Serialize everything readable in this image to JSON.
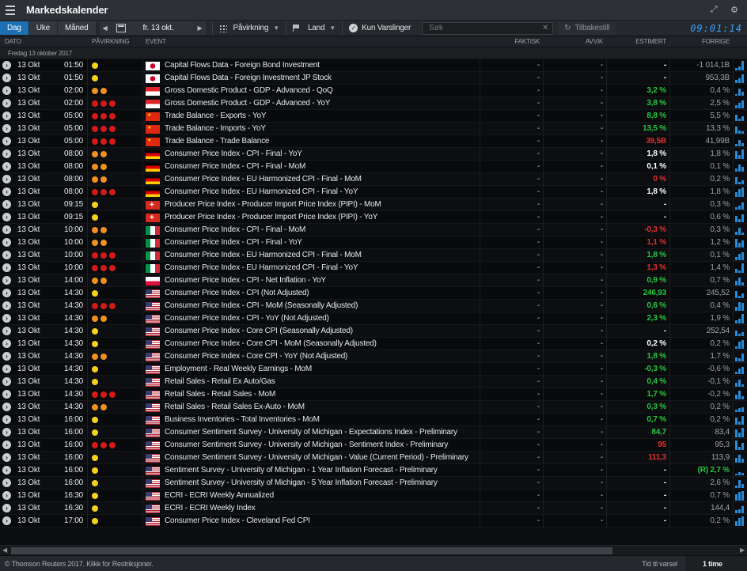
{
  "app": {
    "title": "Markedskalender"
  },
  "toolbar": {
    "tabs": [
      "Dag",
      "Uke",
      "Måned"
    ],
    "date": "fr. 13 okt.",
    "impact_label": "Påvirkning",
    "country_label": "Land",
    "alerts_label": "Kun Varslinger",
    "search_placeholder": "Søk",
    "reset_label": "Tilbakestill",
    "clock": "09:01:14"
  },
  "columns": {
    "date": "DATO",
    "impact": "PÅVIRKNING",
    "event": "EVENT",
    "actual": "FAKTISK",
    "deviation": "AVVIK",
    "estimate": "ESTIMERT",
    "previous": "FORRIGE"
  },
  "group_header": "Fredag 13 oktober 2017",
  "colors": {
    "yellow": "#f2d21c",
    "orange": "#f0911f",
    "red": "#d31a1a",
    "green": "#27c93f",
    "red_text": "#e0312f",
    "white_text": "#ffffff",
    "accent": "#1b6fb2"
  },
  "rows": [
    {
      "date": "13 Okt",
      "time": "01:50",
      "impact": "low",
      "flag": "JP",
      "event": "Capital Flows Data - Foreign Bond Investment",
      "actual": "-",
      "deviation": "-",
      "estimate": "-",
      "est_color": "white",
      "previous": "-1 014,1B"
    },
    {
      "date": "13 Okt",
      "time": "01:50",
      "impact": "low",
      "flag": "JP",
      "event": "Capital Flows Data - Foreign Investment JP Stock",
      "actual": "-",
      "deviation": "-",
      "estimate": "-",
      "est_color": "white",
      "previous": "953,3B"
    },
    {
      "date": "13 Okt",
      "time": "02:00",
      "impact": "med",
      "flag": "SG",
      "event": "Gross Domestic Product - GDP - Advanced - QoQ",
      "actual": "-",
      "deviation": "-",
      "estimate": "3,2 %",
      "est_color": "green",
      "previous": "0,4 %"
    },
    {
      "date": "13 Okt",
      "time": "02:00",
      "impact": "high",
      "flag": "SG",
      "event": "Gross Domestic Product - GDP - Advanced - YoY",
      "actual": "-",
      "deviation": "-",
      "estimate": "3,8 %",
      "est_color": "green",
      "previous": "2,5 %"
    },
    {
      "date": "13 Okt",
      "time": "05:00",
      "impact": "high",
      "flag": "CN",
      "event": "Trade Balance - Exports - YoY",
      "actual": "-",
      "deviation": "-",
      "estimate": "8,8 %",
      "est_color": "green",
      "previous": "5,5 %"
    },
    {
      "date": "13 Okt",
      "time": "05:00",
      "impact": "high",
      "flag": "CN",
      "event": "Trade Balance - Imports - YoY",
      "actual": "-",
      "deviation": "-",
      "estimate": "13,5 %",
      "est_color": "green",
      "previous": "13,3 %"
    },
    {
      "date": "13 Okt",
      "time": "05:00",
      "impact": "high",
      "flag": "CN",
      "event": "Trade Balance - Trade Balance",
      "actual": "-",
      "deviation": "-",
      "estimate": "39,5B",
      "est_color": "red",
      "previous": "41,99B"
    },
    {
      "date": "13 Okt",
      "time": "08:00",
      "impact": "med",
      "flag": "DE",
      "event": "Consumer Price Index - CPI - Final - YoY",
      "actual": "-",
      "deviation": "-",
      "estimate": "1,8 %",
      "est_color": "white",
      "previous": "1,8 %"
    },
    {
      "date": "13 Okt",
      "time": "08:00",
      "impact": "med",
      "flag": "DE",
      "event": "Consumer Price Index - CPI - Final - MoM",
      "actual": "-",
      "deviation": "-",
      "estimate": "0,1 %",
      "est_color": "white",
      "previous": "0,1 %"
    },
    {
      "date": "13 Okt",
      "time": "08:00",
      "impact": "med",
      "flag": "DE",
      "event": "Consumer Price Index - EU Harmonized CPI - Final - MoM",
      "actual": "-",
      "deviation": "-",
      "estimate": "0 %",
      "est_color": "red",
      "previous": "0,2 %"
    },
    {
      "date": "13 Okt",
      "time": "08:00",
      "impact": "high",
      "flag": "DE",
      "event": "Consumer Price Index - EU Harmonized CPI - Final - YoY",
      "actual": "-",
      "deviation": "-",
      "estimate": "1,8 %",
      "est_color": "white",
      "previous": "1,8 %"
    },
    {
      "date": "13 Okt",
      "time": "09:15",
      "impact": "low",
      "flag": "CH",
      "event": "Producer Price Index - Producer Import Price Index (PIPI) - MoM",
      "actual": "-",
      "deviation": "-",
      "estimate": "-",
      "est_color": "white",
      "previous": "0,3 %"
    },
    {
      "date": "13 Okt",
      "time": "09:15",
      "impact": "low",
      "flag": "CH",
      "event": "Producer Price Index - Producer Import Price Index (PIPI) - YoY",
      "actual": "-",
      "deviation": "-",
      "estimate": "-",
      "est_color": "white",
      "previous": "0,6 %"
    },
    {
      "date": "13 Okt",
      "time": "10:00",
      "impact": "med",
      "flag": "IT",
      "event": "Consumer Price Index - CPI - Final - MoM",
      "actual": "-",
      "deviation": "-",
      "estimate": "-0,3 %",
      "est_color": "red",
      "previous": "0,3 %"
    },
    {
      "date": "13 Okt",
      "time": "10:00",
      "impact": "med",
      "flag": "IT",
      "event": "Consumer Price Index - CPI - Final - YoY",
      "actual": "-",
      "deviation": "-",
      "estimate": "1,1 %",
      "est_color": "red",
      "previous": "1,2 %"
    },
    {
      "date": "13 Okt",
      "time": "10:00",
      "impact": "high",
      "flag": "IT",
      "event": "Consumer Price Index - EU Harmonized CPI - Final - MoM",
      "actual": "-",
      "deviation": "-",
      "estimate": "1,8 %",
      "est_color": "green",
      "previous": "0,1 %"
    },
    {
      "date": "13 Okt",
      "time": "10:00",
      "impact": "high",
      "flag": "IT",
      "event": "Consumer Price Index - EU Harmonized CPI - Final - YoY",
      "actual": "-",
      "deviation": "-",
      "estimate": "1,3 %",
      "est_color": "red",
      "previous": "1,4 %"
    },
    {
      "date": "13 Okt",
      "time": "14:00",
      "impact": "med",
      "flag": "PL",
      "event": "Consumer Price Index - CPI - Net Inflation - YoY",
      "actual": "-",
      "deviation": "-",
      "estimate": "0,9 %",
      "est_color": "green",
      "previous": "0,7 %"
    },
    {
      "date": "13 Okt",
      "time": "14:30",
      "impact": "low",
      "flag": "US",
      "event": "Consumer Price Index - CPI (Not Adjusted)",
      "actual": "-",
      "deviation": "-",
      "estimate": "246,93",
      "est_color": "green",
      "previous": "245,52"
    },
    {
      "date": "13 Okt",
      "time": "14:30",
      "impact": "high",
      "flag": "US",
      "event": "Consumer Price Index - CPI - MoM (Seasonally Adjusted)",
      "actual": "-",
      "deviation": "-",
      "estimate": "0,6 %",
      "est_color": "green",
      "previous": "0,4 %"
    },
    {
      "date": "13 Okt",
      "time": "14:30",
      "impact": "med",
      "flag": "US",
      "event": "Consumer Price Index - CPI - YoY (Not Adjusted)",
      "actual": "-",
      "deviation": "-",
      "estimate": "2,3 %",
      "est_color": "green",
      "previous": "1,9 %"
    },
    {
      "date": "13 Okt",
      "time": "14:30",
      "impact": "low",
      "flag": "US",
      "event": "Consumer Price Index - Core CPI (Seasonally Adjusted)",
      "actual": "-",
      "deviation": "-",
      "estimate": "-",
      "est_color": "white",
      "previous": "252,54"
    },
    {
      "date": "13 Okt",
      "time": "14:30",
      "impact": "low",
      "flag": "US",
      "event": "Consumer Price Index - Core CPI - MoM (Seasonally Adjusted)",
      "actual": "-",
      "deviation": "-",
      "estimate": "0,2 %",
      "est_color": "white",
      "previous": "0,2 %"
    },
    {
      "date": "13 Okt",
      "time": "14:30",
      "impact": "med",
      "flag": "US",
      "event": "Consumer Price Index - Core CPI - YoY (Not Adjusted)",
      "actual": "-",
      "deviation": "-",
      "estimate": "1,8 %",
      "est_color": "green",
      "previous": "1,7 %"
    },
    {
      "date": "13 Okt",
      "time": "14:30",
      "impact": "low",
      "flag": "US",
      "event": "Employment - Real Weekly Earnings - MoM",
      "actual": "-",
      "deviation": "-",
      "estimate": "-0,3 %",
      "est_color": "green",
      "previous": "-0,6 %"
    },
    {
      "date": "13 Okt",
      "time": "14:30",
      "impact": "low",
      "flag": "US",
      "event": "Retail Sales - Retail Ex Auto/Gas",
      "actual": "-",
      "deviation": "-",
      "estimate": "0,4 %",
      "est_color": "green",
      "previous": "-0,1 %"
    },
    {
      "date": "13 Okt",
      "time": "14:30",
      "impact": "high",
      "flag": "US",
      "event": "Retail Sales - Retail Sales - MoM",
      "actual": "-",
      "deviation": "-",
      "estimate": "1,7 %",
      "est_color": "green",
      "previous": "-0,2 %"
    },
    {
      "date": "13 Okt",
      "time": "14:30",
      "impact": "med",
      "flag": "US",
      "event": "Retail Sales - Retail Sales Ex-Auto - MoM",
      "actual": "-",
      "deviation": "-",
      "estimate": "0,3 %",
      "est_color": "green",
      "previous": "0,2 %"
    },
    {
      "date": "13 Okt",
      "time": "16:00",
      "impact": "low",
      "flag": "US",
      "event": "Business Inventories - Total Inventories - MoM",
      "actual": "-",
      "deviation": "-",
      "estimate": "0,7 %",
      "est_color": "green",
      "previous": "0,2 %"
    },
    {
      "date": "13 Okt",
      "time": "16:00",
      "impact": "low",
      "flag": "US",
      "event": "Consumer Sentiment Survey - University of Michigan - Expectations Index - Preliminary",
      "actual": "-",
      "deviation": "-",
      "estimate": "84,7",
      "est_color": "green",
      "previous": "83,4"
    },
    {
      "date": "13 Okt",
      "time": "16:00",
      "impact": "high",
      "flag": "US",
      "event": "Consumer Sentiment Survey - University of Michigan - Sentiment Index - Preliminary",
      "actual": "-",
      "deviation": "-",
      "estimate": "95",
      "est_color": "red",
      "previous": "95,3"
    },
    {
      "date": "13 Okt",
      "time": "16:00",
      "impact": "low",
      "flag": "US",
      "event": "Consumer Sentiment Survey - University of Michigan - Value (Current Period) - Preliminary",
      "actual": "-",
      "deviation": "-",
      "estimate": "111,3",
      "est_color": "red",
      "previous": "113,9"
    },
    {
      "date": "13 Okt",
      "time": "16:00",
      "impact": "low",
      "flag": "US",
      "event": "Sentiment Survey - University of Michigan - 1 Year Inflation Forecast - Preliminary",
      "actual": "-",
      "deviation": "-",
      "estimate": "-",
      "est_color": "white",
      "previous": "(R) 2,7 %",
      "prev_color": "green"
    },
    {
      "date": "13 Okt",
      "time": "16:00",
      "impact": "low",
      "flag": "US",
      "event": "Sentiment Survey - University of Michigan - 5 Year Inflation Forecast - Preliminary",
      "actual": "-",
      "deviation": "-",
      "estimate": "-",
      "est_color": "white",
      "previous": "2,6 %"
    },
    {
      "date": "13 Okt",
      "time": "16:30",
      "impact": "low",
      "flag": "US",
      "event": "ECRI - ECRI Weekly Annualized",
      "actual": "-",
      "deviation": "-",
      "estimate": "-",
      "est_color": "white",
      "previous": "0,7 %"
    },
    {
      "date": "13 Okt",
      "time": "16:30",
      "impact": "low",
      "flag": "US",
      "event": "ECRI - ECRI Weekly Index",
      "actual": "-",
      "deviation": "-",
      "estimate": "-",
      "est_color": "white",
      "previous": "144,4"
    },
    {
      "date": "13 Okt",
      "time": "17:00",
      "impact": "low",
      "flag": "US",
      "event": "Consumer Price Index - Cleveland Fed CPI",
      "actual": "-",
      "deviation": "-",
      "estimate": "-",
      "est_color": "white",
      "previous": "0,2 %"
    }
  ],
  "status": {
    "copyright": "© Thomson Reuters 2017. Klikk for Restriksjoner.",
    "time_label": "Tid til varsel",
    "time_value": "1 time"
  }
}
